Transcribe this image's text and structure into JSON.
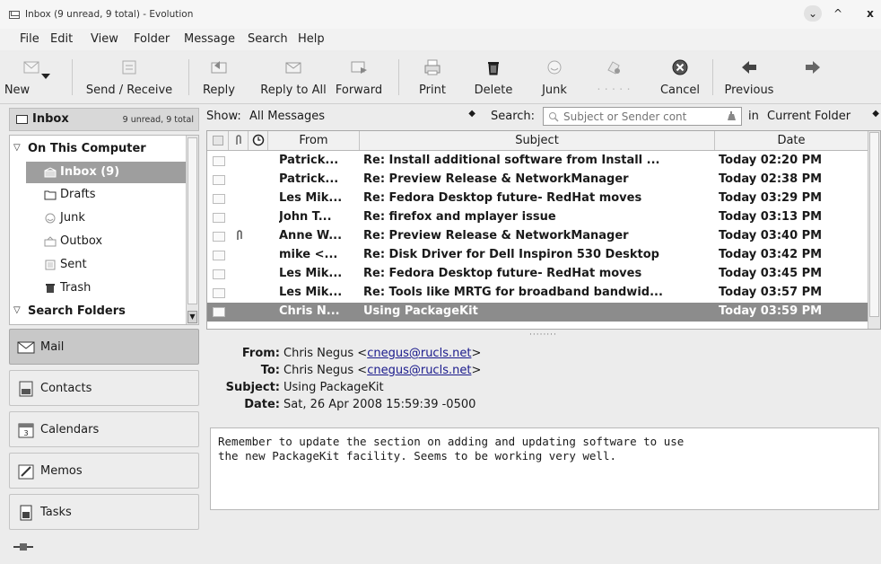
{
  "window": {
    "title": "Inbox (9 unread, 9 total) - Evolution",
    "controls": {
      "minimize": "⌄",
      "maximize": "^",
      "close": "x"
    }
  },
  "menubar": [
    {
      "label": "File"
    },
    {
      "label": "Edit"
    },
    {
      "label": "View"
    },
    {
      "label": "Folder"
    },
    {
      "label": "Message"
    },
    {
      "label": "Search"
    },
    {
      "label": "Help"
    }
  ],
  "toolbar": {
    "new": "New",
    "send_receive": "Send / Receive",
    "reply": "Reply",
    "reply_all": "Reply to All",
    "forward": "Forward",
    "print": "Print",
    "delete": "Delete",
    "junk": "Junk",
    "cancel": "Cancel",
    "previous": "Previous"
  },
  "folder_header": {
    "title": "Inbox",
    "status": "9 unread, 9 total"
  },
  "folders": {
    "on_this_computer": "On This Computer",
    "items": [
      {
        "label": "Inbox (9)",
        "icon": "inbox-icon"
      },
      {
        "label": "Drafts",
        "icon": "drafts-icon"
      },
      {
        "label": "Junk",
        "icon": "junk-icon"
      },
      {
        "label": "Outbox",
        "icon": "outbox-icon"
      },
      {
        "label": "Sent",
        "icon": "sent-icon"
      },
      {
        "label": "Trash",
        "icon": "trash-icon"
      }
    ],
    "search_folders": "Search Folders"
  },
  "switcher": [
    {
      "label": "Mail",
      "icon": "mail-icon"
    },
    {
      "label": "Contacts",
      "icon": "contacts-icon"
    },
    {
      "label": "Calendars",
      "icon": "calendar-icon"
    },
    {
      "label": "Memos",
      "icon": "memo-icon"
    },
    {
      "label": "Tasks",
      "icon": "tasks-icon"
    }
  ],
  "filter": {
    "show_label": "Show:",
    "show_value": "All Messages",
    "search_label": "Search:",
    "search_placeholder": "Subject or Sender cont",
    "in_label": "in",
    "scope_value": "Current Folder"
  },
  "message_list": {
    "columns": {
      "from": "From",
      "subject": "Subject",
      "date": "Date"
    },
    "rows": [
      {
        "from": "Patrick...",
        "subject": "Re: Install additional software from Install ...",
        "date": "Today 02:20 PM",
        "attachment": false
      },
      {
        "from": "Patrick...",
        "subject": "Re: Preview Release & NetworkManager",
        "date": "Today 02:38 PM",
        "attachment": false
      },
      {
        "from": "Les Mik...",
        "subject": "Re: Fedora Desktop future- RedHat moves",
        "date": "Today 03:29 PM",
        "attachment": false
      },
      {
        "from": "John T...",
        "subject": "Re: firefox and mplayer issue",
        "date": "Today 03:13 PM",
        "attachment": false
      },
      {
        "from": "Anne W...",
        "subject": "Re: Preview Release & NetworkManager",
        "date": "Today 03:40 PM",
        "attachment": true
      },
      {
        "from": "mike <...",
        "subject": "Re: Disk Driver for Dell Inspiron 530 Desktop",
        "date": "Today 03:42 PM",
        "attachment": false
      },
      {
        "from": "Les Mik...",
        "subject": "Re: Fedora Desktop future- RedHat moves",
        "date": "Today 03:45 PM",
        "attachment": false
      },
      {
        "from": "Les Mik...",
        "subject": "Re: Tools like MRTG for broadband bandwid...",
        "date": "Today 03:57 PM",
        "attachment": false
      },
      {
        "from": "Chris N...",
        "subject": "Using PackageKit",
        "date": "Today 03:59 PM",
        "attachment": false,
        "selected": true
      }
    ]
  },
  "preview": {
    "from_label": "From:",
    "from_name": "Chris Negus <",
    "from_email": "cnegus@rucls.net",
    "from_end": ">",
    "to_label": "To:",
    "to_name": "Chris Negus <",
    "to_email": "cnegus@rucls.net",
    "to_end": ">",
    "subject_label": "Subject:",
    "subject": "Using PackageKit",
    "date_label": "Date:",
    "date": "Sat, 26 Apr 2008 15:59:39 -0500",
    "body": "Remember to update the section on adding and updating software to use\nthe new PackageKit facility. Seems to be working very well."
  },
  "colors": {
    "selection": "#8c8c8c",
    "link": "#1a1a8c"
  }
}
